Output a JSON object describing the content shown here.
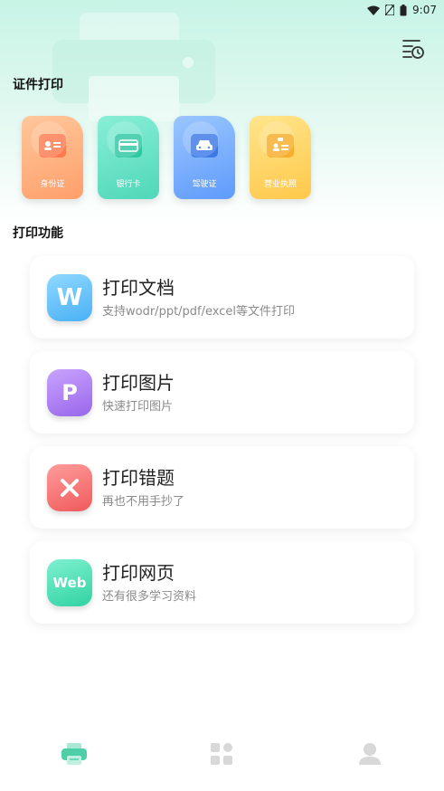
{
  "status_bar": {
    "time": "9:07"
  },
  "header": {
    "history_icon": "history-list-icon"
  },
  "id_print": {
    "title": "证件打印",
    "cards": [
      {
        "label": "身份证",
        "icon": "id-card-icon",
        "color": "#ff9f6b"
      },
      {
        "label": "银行卡",
        "icon": "bank-card-icon",
        "color": "#4fd7b8"
      },
      {
        "label": "驾驶证",
        "icon": "car-icon",
        "color": "#5f9bfb"
      },
      {
        "label": "营业执照",
        "icon": "license-icon",
        "color": "#ffc84a"
      }
    ]
  },
  "print_functions": {
    "title": "打印功能",
    "items": [
      {
        "icon_text": "W",
        "title": "打印文档",
        "subtitle": "支持wodr/ppt/pdf/excel等文件打印"
      },
      {
        "icon_text": "P",
        "title": "打印图片",
        "subtitle": "快速打印图片"
      },
      {
        "icon_text": "",
        "title": "打印错题",
        "subtitle": "再也不用手抄了"
      },
      {
        "icon_text": "Web",
        "title": "打印网页",
        "subtitle": "还有很多学习资料"
      }
    ]
  },
  "tabbar": {
    "tabs": [
      {
        "icon": "printer-icon",
        "active": true
      },
      {
        "icon": "apps-icon",
        "active": false
      },
      {
        "icon": "profile-icon",
        "active": false
      }
    ],
    "active_color": "#4fcfa8",
    "inactive_color": "#d8d8d8"
  }
}
